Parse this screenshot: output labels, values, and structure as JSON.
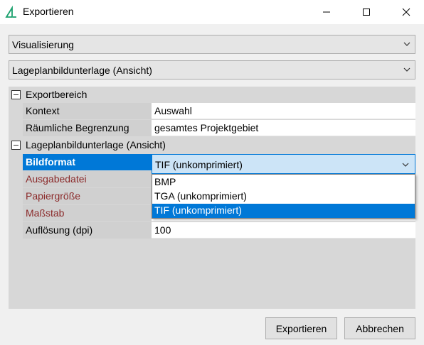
{
  "window": {
    "title": "Exportieren",
    "accent": "#0078d7"
  },
  "combos": {
    "visualization": {
      "value": "Visualisierung"
    },
    "layer": {
      "value": "Lageplanbildunterlage (Ansicht)"
    }
  },
  "grid": {
    "cat_export": "Exportbereich",
    "context_label": "Kontext",
    "context_value": "Auswahl",
    "spatial_label": "Räumliche Begrenzung",
    "spatial_value": "gesamtes Projektgebiet",
    "cat_layer": "Lageplanbildunterlage (Ansicht)",
    "format_label": "Bildformat",
    "format_value": "TIF (unkomprimiert)",
    "output_label": "Ausgabedatei",
    "paper_label": "Papiergröße",
    "scale_label": "Maßstab",
    "resolution_label": "Auflösung (dpi)",
    "resolution_value": "100"
  },
  "dropdown": {
    "options": [
      "BMP",
      "TGA (unkomprimiert)",
      "TIF (unkomprimiert)"
    ],
    "selected": "TIF (unkomprimiert)"
  },
  "buttons": {
    "export": "Exportieren",
    "cancel": "Abbrechen"
  }
}
